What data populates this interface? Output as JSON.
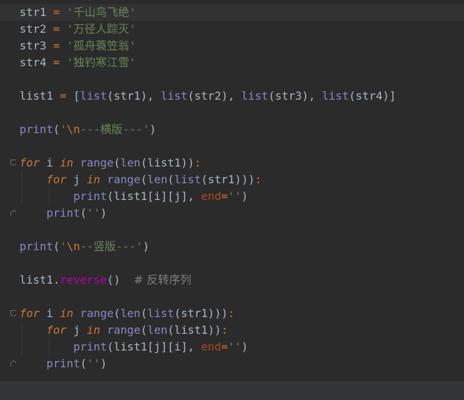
{
  "editor": {
    "lines": [
      {
        "t": [
          [
            "var",
            "str1"
          ],
          [
            "plain",
            " "
          ],
          [
            "op",
            "="
          ],
          [
            "plain",
            " "
          ],
          [
            "str",
            "'千山鸟飞绝'"
          ]
        ]
      },
      {
        "t": [
          [
            "var",
            "str2"
          ],
          [
            "plain",
            " "
          ],
          [
            "op",
            "="
          ],
          [
            "plain",
            " "
          ],
          [
            "str",
            "'万径人踪灭'"
          ]
        ]
      },
      {
        "t": [
          [
            "var",
            "str3"
          ],
          [
            "plain",
            " "
          ],
          [
            "op",
            "="
          ],
          [
            "plain",
            " "
          ],
          [
            "str",
            "'孤舟蓑笠翁'"
          ]
        ]
      },
      {
        "t": [
          [
            "var",
            "str4"
          ],
          [
            "plain",
            " "
          ],
          [
            "op",
            "="
          ],
          [
            "plain",
            " "
          ],
          [
            "str",
            "'独钓寒江雪'"
          ]
        ]
      },
      {
        "t": []
      },
      {
        "t": [
          [
            "var",
            "list1"
          ],
          [
            "plain",
            " "
          ],
          [
            "op",
            "="
          ],
          [
            "plain",
            " ["
          ],
          [
            "builtin",
            "list"
          ],
          [
            "plain",
            "(str1), "
          ],
          [
            "builtin",
            "list"
          ],
          [
            "plain",
            "(str2), "
          ],
          [
            "builtin",
            "list"
          ],
          [
            "plain",
            "(str3), "
          ],
          [
            "builtin",
            "list"
          ],
          [
            "plain",
            "(str4)]"
          ]
        ]
      },
      {
        "t": []
      },
      {
        "t": [
          [
            "builtin",
            "print"
          ],
          [
            "plain",
            "("
          ],
          [
            "str",
            "'"
          ],
          [
            "esc",
            "\\n"
          ],
          [
            "str",
            "---横版---'"
          ],
          [
            "plain",
            ")"
          ]
        ]
      },
      {
        "t": []
      },
      {
        "t": [
          [
            "kw",
            "for"
          ],
          [
            "plain",
            " i "
          ],
          [
            "kw",
            "in"
          ],
          [
            "plain",
            " "
          ],
          [
            "builtin",
            "range"
          ],
          [
            "plain",
            "("
          ],
          [
            "builtin",
            "len"
          ],
          [
            "plain",
            "(list1))"
          ],
          [
            "op",
            ":"
          ]
        ]
      },
      {
        "t": [
          [
            "plain",
            "    "
          ],
          [
            "kw",
            "for"
          ],
          [
            "plain",
            " j "
          ],
          [
            "kw",
            "in"
          ],
          [
            "plain",
            " "
          ],
          [
            "builtin",
            "range"
          ],
          [
            "plain",
            "("
          ],
          [
            "builtin",
            "len"
          ],
          [
            "plain",
            "("
          ],
          [
            "builtin",
            "list"
          ],
          [
            "plain",
            "(str1)))"
          ],
          [
            "op",
            ":"
          ]
        ]
      },
      {
        "t": [
          [
            "plain",
            "        "
          ],
          [
            "builtin",
            "print"
          ],
          [
            "plain",
            "(list1[i][j], "
          ],
          [
            "kwarg",
            "end"
          ],
          [
            "op",
            "="
          ],
          [
            "str",
            "''"
          ],
          [
            "plain",
            ")"
          ]
        ]
      },
      {
        "t": [
          [
            "plain",
            "    "
          ],
          [
            "builtin",
            "print"
          ],
          [
            "plain",
            "("
          ],
          [
            "str",
            "''"
          ],
          [
            "plain",
            ")"
          ]
        ]
      },
      {
        "t": []
      },
      {
        "t": [
          [
            "builtin",
            "print"
          ],
          [
            "plain",
            "("
          ],
          [
            "str",
            "'"
          ],
          [
            "esc",
            "\\n"
          ],
          [
            "str",
            "--竖版---'"
          ],
          [
            "plain",
            ")"
          ]
        ]
      },
      {
        "t": []
      },
      {
        "t": [
          [
            "var",
            "list1"
          ],
          [
            "plain",
            "."
          ],
          [
            "method",
            "reverse"
          ],
          [
            "plain",
            "()  "
          ],
          [
            "comment",
            "# 反转序列"
          ]
        ]
      },
      {
        "t": []
      },
      {
        "t": [
          [
            "kw",
            "for"
          ],
          [
            "plain",
            " i "
          ],
          [
            "kw",
            "in"
          ],
          [
            "plain",
            " "
          ],
          [
            "builtin",
            "range"
          ],
          [
            "plain",
            "("
          ],
          [
            "builtin",
            "len"
          ],
          [
            "plain",
            "("
          ],
          [
            "builtin",
            "list"
          ],
          [
            "plain",
            "(str1)))"
          ],
          [
            "op",
            ":"
          ]
        ]
      },
      {
        "t": [
          [
            "plain",
            "    "
          ],
          [
            "kw",
            "for"
          ],
          [
            "plain",
            " j "
          ],
          [
            "kw",
            "in"
          ],
          [
            "plain",
            " "
          ],
          [
            "builtin",
            "range"
          ],
          [
            "plain",
            "("
          ],
          [
            "builtin",
            "len"
          ],
          [
            "plain",
            "(list1))"
          ],
          [
            "op",
            ":"
          ]
        ]
      },
      {
        "t": [
          [
            "plain",
            "        "
          ],
          [
            "builtin",
            "print"
          ],
          [
            "plain",
            "(list1[j][i], "
          ],
          [
            "kwarg",
            "end"
          ],
          [
            "op",
            "="
          ],
          [
            "str",
            "''"
          ],
          [
            "plain",
            ")"
          ]
        ]
      },
      {
        "t": [
          [
            "plain",
            "    "
          ],
          [
            "builtin",
            "print"
          ],
          [
            "plain",
            "("
          ],
          [
            "str",
            "''"
          ],
          [
            "plain",
            ")"
          ]
        ]
      }
    ],
    "current_line": 1,
    "fold_markers": [
      {
        "line": 10,
        "type": "open"
      },
      {
        "line": 13,
        "type": "close"
      },
      {
        "line": 19,
        "type": "open"
      },
      {
        "line": 22,
        "type": "close"
      }
    ]
  },
  "colors": {
    "background": "#2b2b2b",
    "current_line": "#323232",
    "keyword": "#cc7832",
    "string": "#6a8759",
    "builtin": "#8888c6",
    "kwarg": "#aa4926",
    "method": "#b200b2",
    "comment": "#808080"
  }
}
